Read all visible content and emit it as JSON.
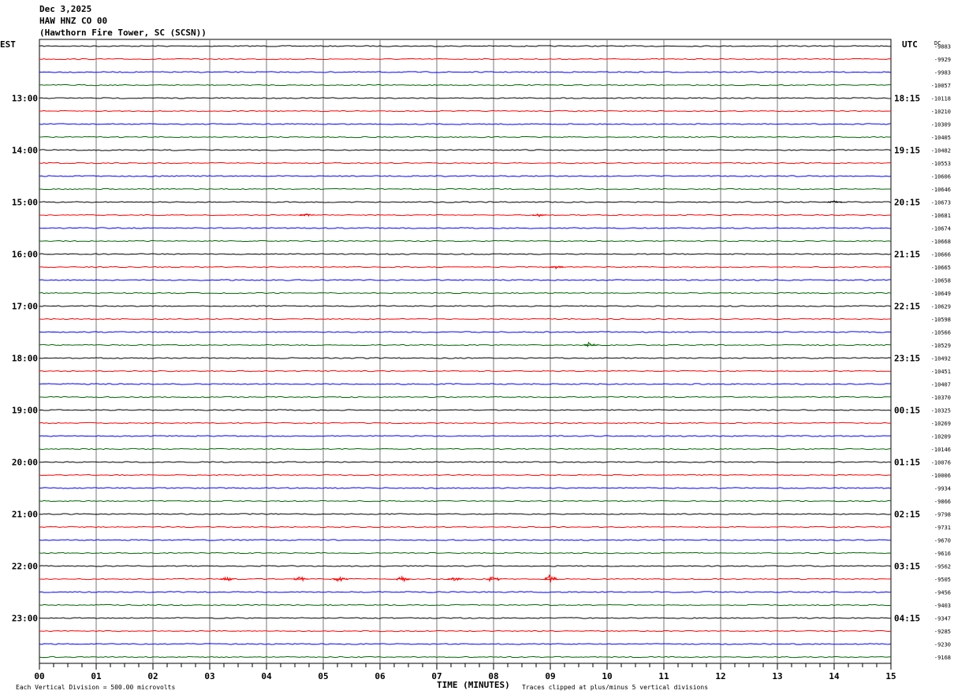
{
  "header": {
    "date": "Dec 3,2025",
    "station": "HAW HNZ CO 00",
    "site": "(Hawthorn Fire Tower, SC (SCSN))"
  },
  "left_tz": "EST",
  "right_tz": "UTC",
  "dc_header": "DC",
  "footer": {
    "mark": "",
    "scale": "Each Vertical Division =  500.00 microvolts",
    "clip": "Traces clipped at plus/minus 5 vertical divisions"
  },
  "chart_data": {
    "type": "line",
    "xlabel": "TIME (MINUTES)",
    "x_ticks": [
      "00",
      "01",
      "02",
      "03",
      "04",
      "05",
      "06",
      "07",
      "08",
      "09",
      "10",
      "11",
      "12",
      "13",
      "14",
      "15"
    ],
    "xlim": [
      0,
      15
    ],
    "trace_colors": [
      "#000000",
      "#ff0000",
      "#0000ff",
      "#006600"
    ],
    "left_hour_labels": [
      "13:00",
      "14:00",
      "15:00",
      "16:00",
      "17:00",
      "18:00",
      "19:00",
      "20:00",
      "21:00",
      "22:00",
      "23:00"
    ],
    "right_hour_labels": [
      "18:15",
      "19:15",
      "20:15",
      "21:15",
      "22:15",
      "23:15",
      "00:15",
      "01:15",
      "02:15",
      "03:15",
      "04:15"
    ],
    "dc_offsets": [
      "-9883",
      "-9929",
      "-9983",
      "-10057",
      "-10118",
      "-10210",
      "-10309",
      "-10405",
      "-10482",
      "-10553",
      "-10606",
      "-10646",
      "-10673",
      "-10681",
      "-10674",
      "-10668",
      "-10666",
      "-10665",
      "-10658",
      "-10649",
      "-10629",
      "-10598",
      "-10566",
      "-10529",
      "-10492",
      "-10451",
      "-10407",
      "-10370",
      "-10325",
      "-10269",
      "-10209",
      "-10146",
      "-10076",
      "-10006",
      "-9934",
      "-9866",
      "-9798",
      "-9731",
      "-9670",
      "-9616",
      "-9562",
      "-9505",
      "-9456",
      "-9403",
      "-9347",
      "-9285",
      "-9230",
      "-9168"
    ],
    "events": [
      {
        "trace": 41,
        "minute": 3.3,
        "amp": 4
      },
      {
        "trace": 41,
        "minute": 4.6,
        "amp": 4
      },
      {
        "trace": 41,
        "minute": 5.3,
        "amp": 5
      },
      {
        "trace": 41,
        "minute": 6.4,
        "amp": 5
      },
      {
        "trace": 41,
        "minute": 7.3,
        "amp": 4
      },
      {
        "trace": 41,
        "minute": 8.0,
        "amp": 7
      },
      {
        "trace": 41,
        "minute": 9.0,
        "amp": 7
      },
      {
        "trace": 23,
        "minute": 9.7,
        "amp": 5
      },
      {
        "trace": 13,
        "minute": 4.7,
        "amp": 2
      },
      {
        "trace": 13,
        "minute": 8.8,
        "amp": 2
      },
      {
        "trace": 12,
        "minute": 14.0,
        "amp": 2
      },
      {
        "trace": 17,
        "minute": 9.1,
        "amp": 2
      }
    ]
  }
}
